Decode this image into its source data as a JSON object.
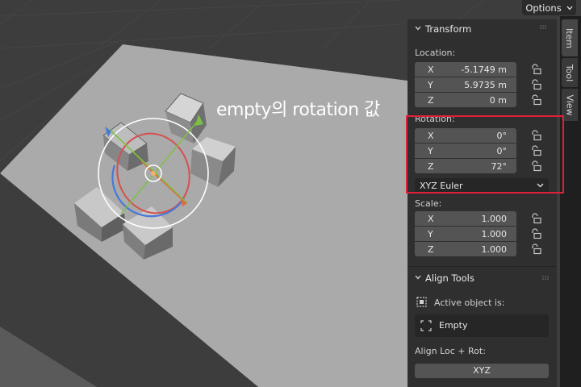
{
  "header": {
    "options_label": "Options"
  },
  "annotation": {
    "caption": "empty의 rotation 값"
  },
  "tabs": [
    {
      "label": "Item",
      "active": true
    },
    {
      "label": "Tool",
      "active": false
    },
    {
      "label": "View",
      "active": false
    }
  ],
  "transform": {
    "title": "Transform",
    "location": {
      "label": "Location:",
      "x": {
        "axis": "X",
        "value": "-5.1749 m"
      },
      "y": {
        "axis": "Y",
        "value": "5.9735 m"
      },
      "z": {
        "axis": "Z",
        "value": "0 m"
      }
    },
    "rotation": {
      "label": "Rotation:",
      "x": {
        "axis": "X",
        "value": "0°"
      },
      "y": {
        "axis": "Y",
        "value": "0°"
      },
      "z": {
        "axis": "Z",
        "value": "72°"
      },
      "mode": "XYZ Euler"
    },
    "scale": {
      "label": "Scale:",
      "x": {
        "axis": "X",
        "value": "1.000"
      },
      "y": {
        "axis": "Y",
        "value": "1.000"
      },
      "z": {
        "axis": "Z",
        "value": "1.000"
      }
    }
  },
  "align_tools": {
    "title": "Align Tools",
    "active_label": "Active object is:",
    "object_name": "Empty",
    "align_label": "Align Loc + Rot:",
    "xyz_button": "XYZ"
  },
  "colors": {
    "highlight": "#e0203a",
    "panel_bg": "#2f2f2f",
    "field_bg": "#545454",
    "viewport_plane": "#a9aaa9"
  }
}
